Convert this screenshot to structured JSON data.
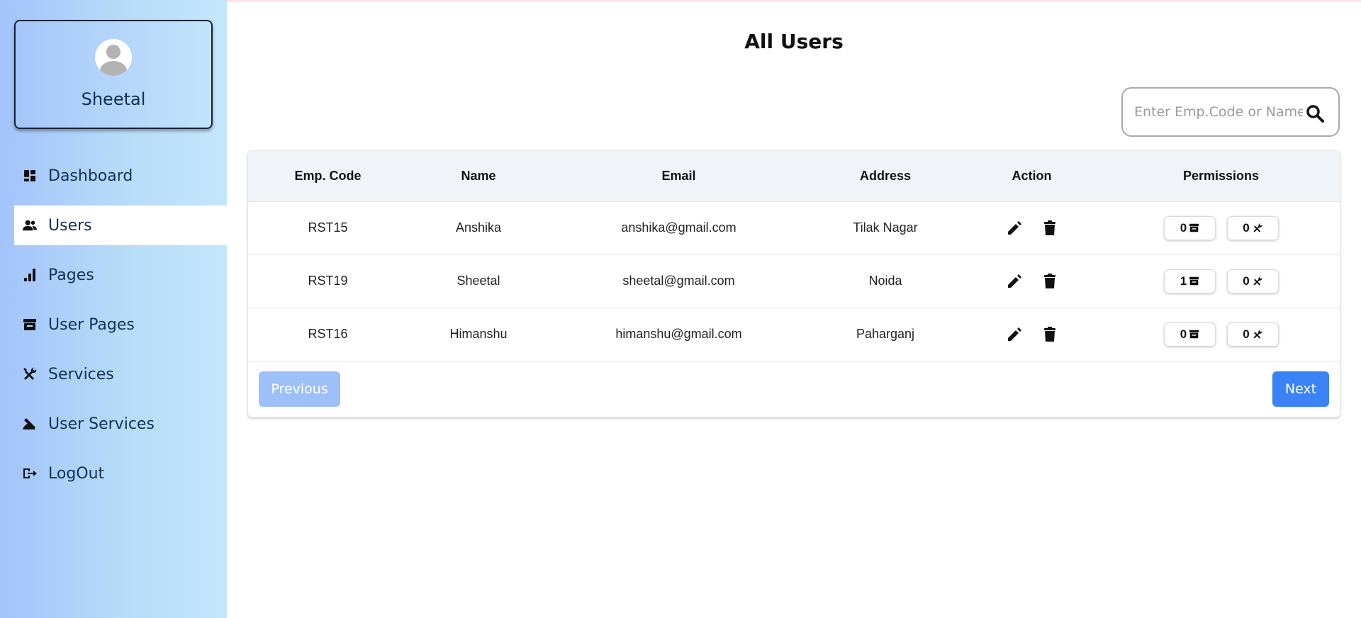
{
  "profile": {
    "name": "Sheetal"
  },
  "sidebar": {
    "items": [
      {
        "label": "Dashboard",
        "icon": "dashboard-icon",
        "active": false
      },
      {
        "label": "Users",
        "icon": "users-icon",
        "active": true
      },
      {
        "label": "Pages",
        "icon": "bar-chart-icon",
        "active": false
      },
      {
        "label": "User Pages",
        "icon": "archive-icon",
        "active": false
      },
      {
        "label": "Services",
        "icon": "tools-icon",
        "active": false
      },
      {
        "label": "User Services",
        "icon": "user-tools-icon",
        "active": false
      },
      {
        "label": "LogOut",
        "icon": "logout-icon",
        "active": false
      }
    ]
  },
  "page": {
    "title": "All Users"
  },
  "search": {
    "placeholder": "Enter Emp.Code or Name",
    "value": ""
  },
  "table": {
    "headers": [
      "Emp. Code",
      "Name",
      "Email",
      "Address",
      "Action",
      "Permissions"
    ],
    "rows": [
      {
        "code": "RST15",
        "name": "Anshika",
        "email": "anshika@gmail.com",
        "address": "Tilak Nagar",
        "pages": "0",
        "services": "0"
      },
      {
        "code": "RST19",
        "name": "Sheetal",
        "email": "sheetal@gmail.com",
        "address": "Noida",
        "pages": "1",
        "services": "0"
      },
      {
        "code": "RST16",
        "name": "Himanshu",
        "email": "himanshu@gmail.com",
        "address": "Paharganj",
        "pages": "0",
        "services": "0"
      }
    ]
  },
  "pagination": {
    "previous": "Previous",
    "next": "Next"
  },
  "colors": {
    "accent": "#3b82f6",
    "accent_disabled": "#9ec0f8",
    "sidebar_start": "#a3c3fb",
    "sidebar_end": "#c3e6fa"
  }
}
